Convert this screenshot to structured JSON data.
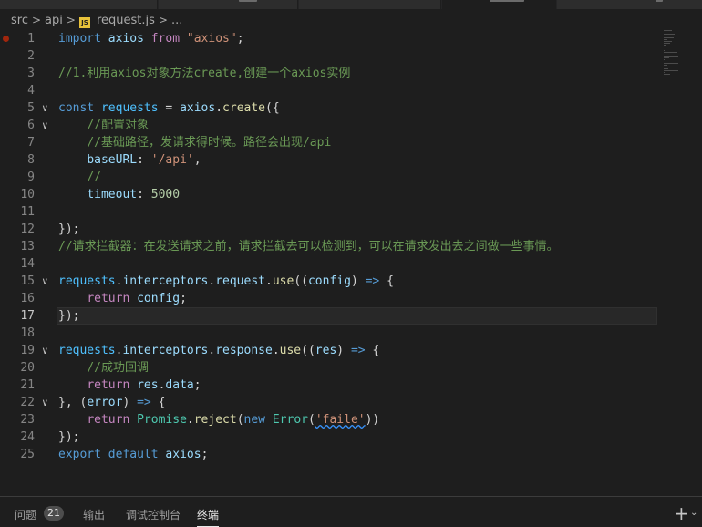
{
  "breadcrumb": {
    "items": [
      "src",
      "api",
      "request.js",
      "..."
    ],
    "separator": ">",
    "file_icon": "JS"
  },
  "editor": {
    "current_line": 17,
    "lines": [
      {
        "n": "1",
        "fold": "",
        "tokens": [
          [
            "kw",
            "import"
          ],
          [
            "pun",
            " "
          ],
          [
            "var",
            "axios"
          ],
          [
            "pun",
            " "
          ],
          [
            "ctl",
            "from"
          ],
          [
            "pun",
            " "
          ],
          [
            "str",
            "\"axios\""
          ],
          [
            "pun",
            ";"
          ]
        ]
      },
      {
        "n": "2",
        "fold": "",
        "tokens": []
      },
      {
        "n": "3",
        "fold": "",
        "tokens": [
          [
            "cmt",
            "//1.利用axios对象方法create,创建一个axios实例"
          ]
        ]
      },
      {
        "n": "4",
        "fold": "",
        "tokens": []
      },
      {
        "n": "5",
        "fold": "v",
        "tokens": [
          [
            "kw",
            "const"
          ],
          [
            "pun",
            " "
          ],
          [
            "cst",
            "requests"
          ],
          [
            "pun",
            " = "
          ],
          [
            "var",
            "axios"
          ],
          [
            "pun",
            "."
          ],
          [
            "fn",
            "create"
          ],
          [
            "pun",
            "({"
          ]
        ]
      },
      {
        "n": "6",
        "fold": "v",
        "tokens": [
          [
            "pun",
            "    "
          ],
          [
            "cmt",
            "//配置对象"
          ]
        ]
      },
      {
        "n": "7",
        "fold": "",
        "tokens": [
          [
            "pun",
            "    "
          ],
          [
            "cmt",
            "//基础路径，发请求得时候。路径会出现/api"
          ]
        ]
      },
      {
        "n": "8",
        "fold": "",
        "tokens": [
          [
            "pun",
            "    "
          ],
          [
            "var",
            "baseURL"
          ],
          [
            "pun",
            ": "
          ],
          [
            "str",
            "'/api'"
          ],
          [
            "pun",
            ","
          ]
        ]
      },
      {
        "n": "9",
        "fold": "",
        "tokens": [
          [
            "pun",
            "    "
          ],
          [
            "cmt",
            "//"
          ]
        ]
      },
      {
        "n": "10",
        "fold": "",
        "tokens": [
          [
            "pun",
            "    "
          ],
          [
            "var",
            "timeout"
          ],
          [
            "pun",
            ": "
          ],
          [
            "num",
            "5000"
          ]
        ]
      },
      {
        "n": "11",
        "fold": "",
        "tokens": []
      },
      {
        "n": "12",
        "fold": "",
        "tokens": [
          [
            "pun",
            "});"
          ]
        ]
      },
      {
        "n": "13",
        "fold": "",
        "tokens": [
          [
            "cmt",
            "//请求拦截器：在发送请求之前，请求拦截去可以检测到，可以在请求发出去之间做一些事情。"
          ]
        ]
      },
      {
        "n": "14",
        "fold": "",
        "tokens": []
      },
      {
        "n": "15",
        "fold": "v",
        "tokens": [
          [
            "cst",
            "requests"
          ],
          [
            "pun",
            "."
          ],
          [
            "var",
            "interceptors"
          ],
          [
            "pun",
            "."
          ],
          [
            "var",
            "request"
          ],
          [
            "pun",
            "."
          ],
          [
            "fn",
            "use"
          ],
          [
            "pun",
            "(("
          ],
          [
            "var",
            "config"
          ],
          [
            "pun",
            ") "
          ],
          [
            "kw",
            "=>"
          ],
          [
            "pun",
            " {"
          ]
        ]
      },
      {
        "n": "16",
        "fold": "",
        "tokens": [
          [
            "pun",
            "    "
          ],
          [
            "ctl",
            "return"
          ],
          [
            "pun",
            " "
          ],
          [
            "var",
            "config"
          ],
          [
            "pun",
            ";"
          ]
        ]
      },
      {
        "n": "17",
        "fold": "",
        "tokens": [
          [
            "pun",
            "});"
          ]
        ]
      },
      {
        "n": "18",
        "fold": "",
        "tokens": []
      },
      {
        "n": "19",
        "fold": "v",
        "tokens": [
          [
            "cst",
            "requests"
          ],
          [
            "pun",
            "."
          ],
          [
            "var",
            "interceptors"
          ],
          [
            "pun",
            "."
          ],
          [
            "var",
            "response"
          ],
          [
            "pun",
            "."
          ],
          [
            "fn",
            "use"
          ],
          [
            "pun",
            "(("
          ],
          [
            "var",
            "res"
          ],
          [
            "pun",
            ") "
          ],
          [
            "kw",
            "=>"
          ],
          [
            "pun",
            " {"
          ]
        ]
      },
      {
        "n": "20",
        "fold": "",
        "tokens": [
          [
            "pun",
            "    "
          ],
          [
            "cmt",
            "//成功回调"
          ]
        ]
      },
      {
        "n": "21",
        "fold": "",
        "tokens": [
          [
            "pun",
            "    "
          ],
          [
            "ctl",
            "return"
          ],
          [
            "pun",
            " "
          ],
          [
            "var",
            "res"
          ],
          [
            "pun",
            "."
          ],
          [
            "var",
            "data"
          ],
          [
            "pun",
            ";"
          ]
        ]
      },
      {
        "n": "22",
        "fold": "v",
        "tokens": [
          [
            "pun",
            "}, ("
          ],
          [
            "var",
            "error"
          ],
          [
            "pun",
            ") "
          ],
          [
            "kw",
            "=>"
          ],
          [
            "pun",
            " {"
          ]
        ]
      },
      {
        "n": "23",
        "fold": "",
        "tokens": [
          [
            "pun",
            "    "
          ],
          [
            "ctl",
            "return"
          ],
          [
            "pun",
            " "
          ],
          [
            "cls",
            "Promise"
          ],
          [
            "pun",
            "."
          ],
          [
            "fn",
            "reject"
          ],
          [
            "pun",
            "("
          ],
          [
            "kw",
            "new"
          ],
          [
            "pun",
            " "
          ],
          [
            "cls",
            "Error"
          ],
          [
            "pun",
            "("
          ],
          [
            "str",
            "'faile'"
          ],
          [
            "pun",
            "))"
          ]
        ]
      },
      {
        "n": "24",
        "fold": "",
        "tokens": [
          [
            "pun",
            "});"
          ]
        ]
      },
      {
        "n": "25",
        "fold": "",
        "tokens": [
          [
            "kw",
            "export"
          ],
          [
            "pun",
            " "
          ],
          [
            "kw",
            "default"
          ],
          [
            "pun",
            " "
          ],
          [
            "var",
            "axios"
          ],
          [
            "pun",
            ";"
          ]
        ]
      }
    ]
  },
  "panel": {
    "tabs": [
      {
        "label": "问题",
        "badge": "21"
      },
      {
        "label": "输出"
      },
      {
        "label": "调试控制台"
      },
      {
        "label": "终端",
        "active": true
      }
    ],
    "new_terminal_icon": "plus-icon",
    "dropdown_icon": "chevron-down-icon"
  },
  "colors": {
    "background": "#1e1e1e",
    "keyword": "#569cd6",
    "control": "#c586c0",
    "variable": "#9cdcfe",
    "constant": "#4fc1ff",
    "function": "#dcdcaa",
    "string": "#ce9178",
    "number": "#b5cea8",
    "comment": "#6a9955",
    "class": "#4ec9b0",
    "breakpoint": "#a1260d"
  }
}
